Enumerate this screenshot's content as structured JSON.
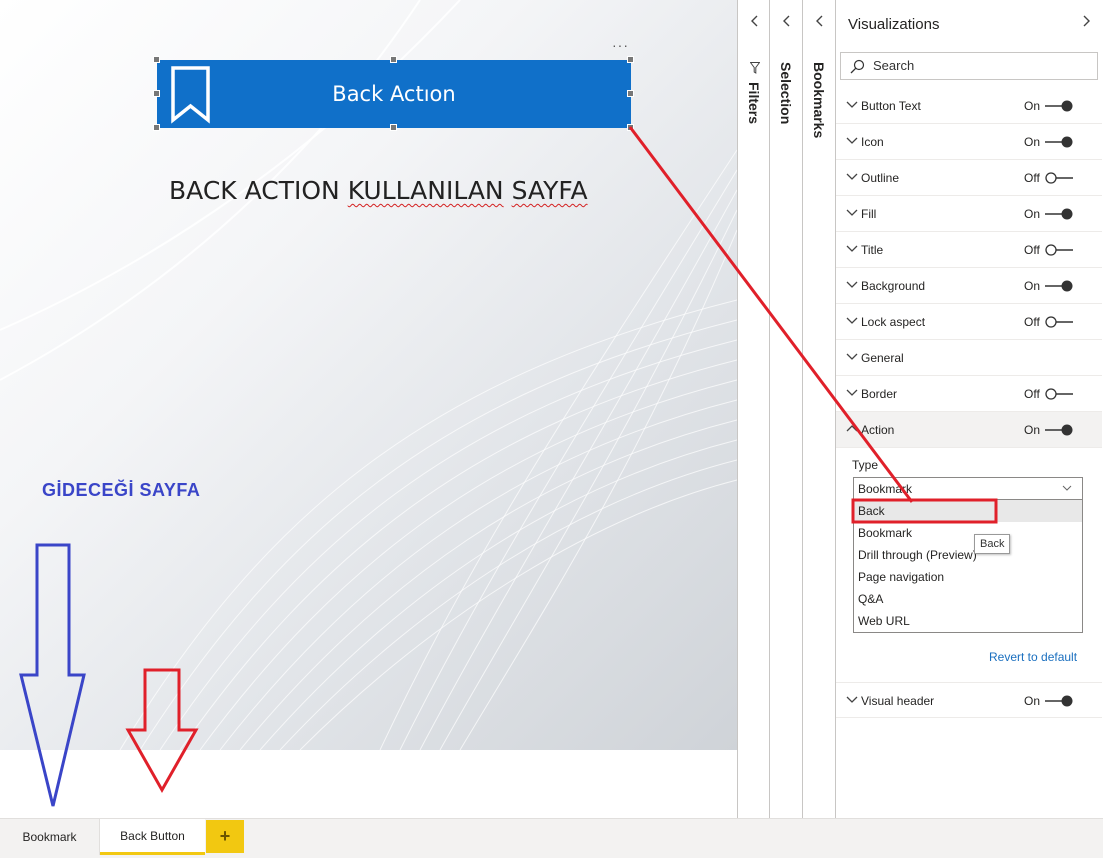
{
  "canvas": {
    "button_visual_label": "Back Actıon",
    "heading_part1": "BACK ACTION ",
    "heading_squiggle1": "KULLANILAN",
    "heading_space": " ",
    "heading_squiggle2": "SAYFA",
    "target_label": "GİDECEĞİ SAYFA",
    "more_options": "···"
  },
  "panes": {
    "filters": "Filters",
    "selection": "Selection",
    "bookmarks": "Bookmarks"
  },
  "viz": {
    "title": "Visualizations",
    "search_placeholder": "Search",
    "rows": [
      {
        "label": "Button Text",
        "state": "On"
      },
      {
        "label": "Icon",
        "state": "On"
      },
      {
        "label": "Outline",
        "state": "Off"
      },
      {
        "label": "Fill",
        "state": "On"
      },
      {
        "label": "Title",
        "state": "Off"
      },
      {
        "label": "Background",
        "state": "On"
      },
      {
        "label": "Lock aspect",
        "state": "Off"
      },
      {
        "label": "General",
        "state": ""
      },
      {
        "label": "Border",
        "state": "Off"
      },
      {
        "label": "Action",
        "state": "On"
      }
    ],
    "type_label": "Type",
    "type_value": "Bookmark",
    "type_options": [
      "Back",
      "Bookmark",
      "Drill through (Preview)",
      "Page navigation",
      "Q&A",
      "Web URL"
    ],
    "tooltip": "Back",
    "revert": "Revert to default",
    "visual_header": {
      "label": "Visual header",
      "state": "On"
    }
  },
  "tabs": {
    "items": [
      "Bookmark",
      "Back Button"
    ],
    "active": "Back Button",
    "add": "+"
  },
  "colors": {
    "button_fill": "#1070c9",
    "accent_yellow": "#f2c811",
    "annotation_red": "#e0202a",
    "annotation_blue": "#3a45c8"
  }
}
